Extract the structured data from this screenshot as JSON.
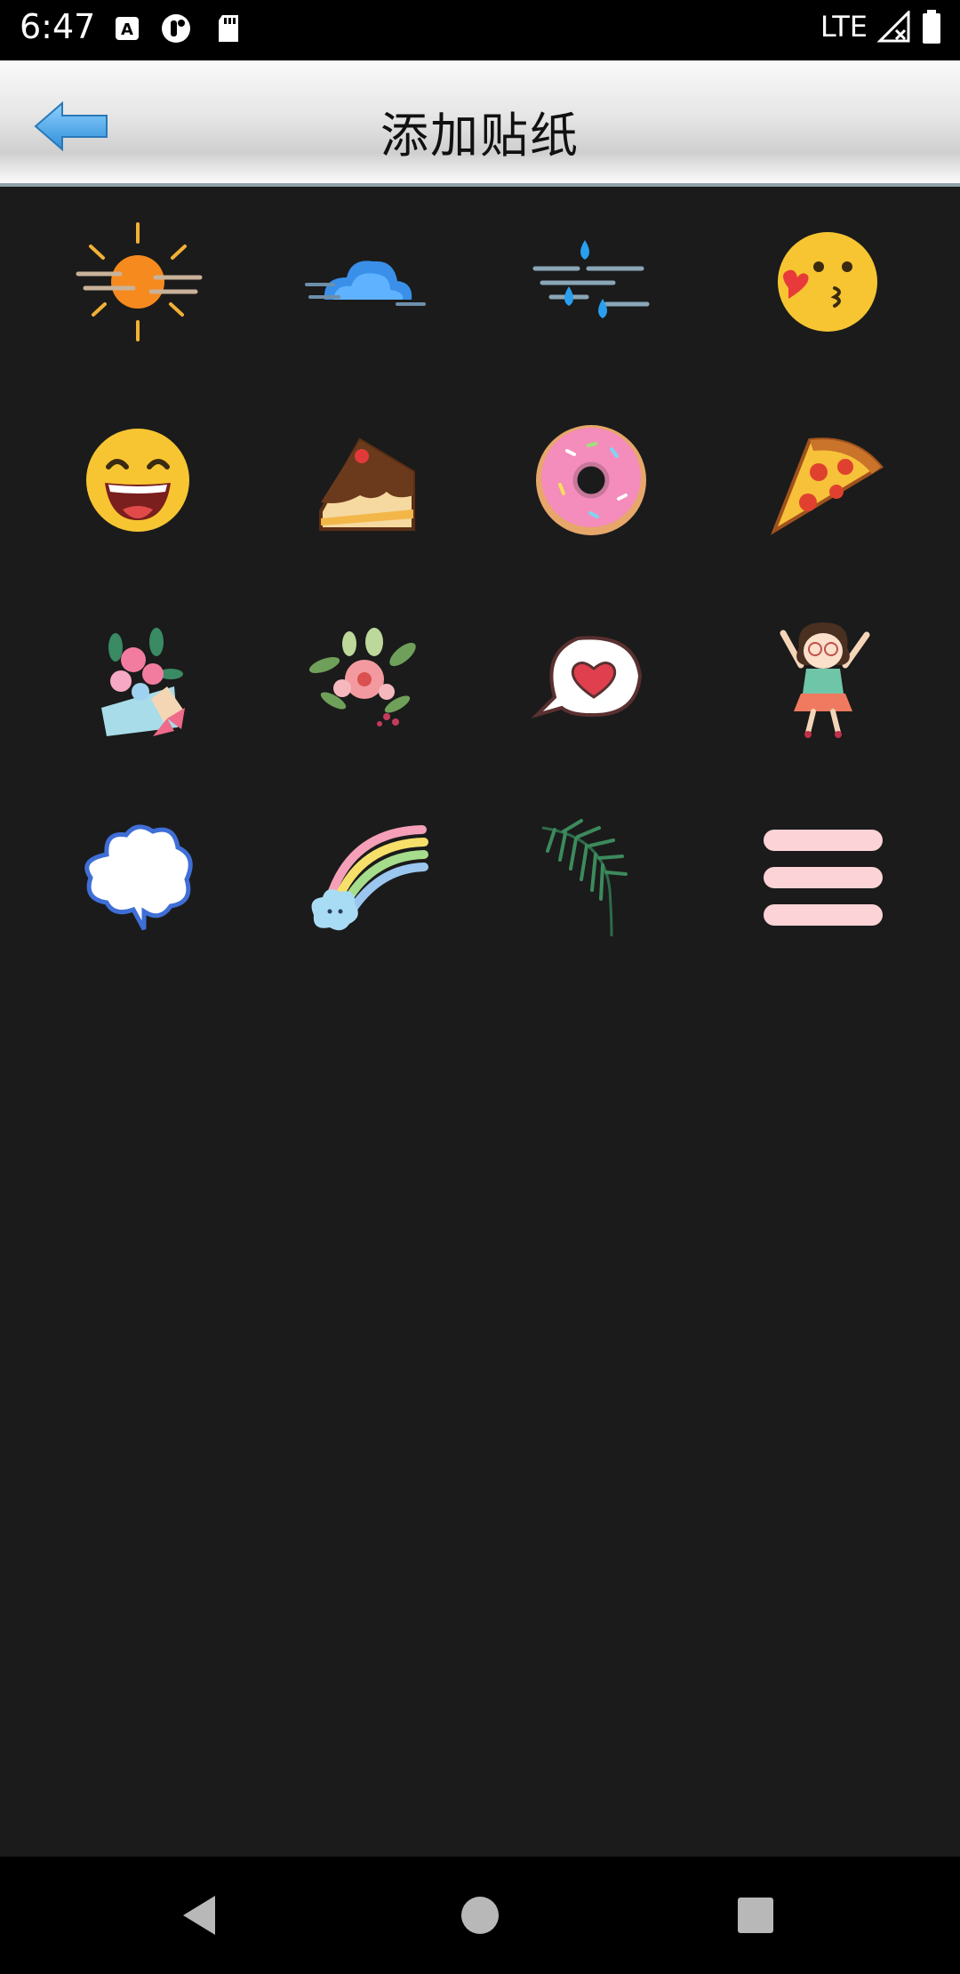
{
  "status_bar": {
    "time": "6:47",
    "network": "LTE",
    "icons": [
      "a-box-icon",
      "vpn-key-icon",
      "sd-card-icon",
      "signal-icon",
      "battery-icon"
    ]
  },
  "header": {
    "title": "添加贴纸",
    "back_icon": "back-arrow-icon",
    "accent": "#4aa6e8"
  },
  "stickers": [
    {
      "name": "sun"
    },
    {
      "name": "cloud"
    },
    {
      "name": "rain"
    },
    {
      "name": "kiss-emoji"
    },
    {
      "name": "grin-emoji"
    },
    {
      "name": "cake-slice"
    },
    {
      "name": "donut"
    },
    {
      "name": "pizza"
    },
    {
      "name": "flower-bouquet"
    },
    {
      "name": "flower-wreath"
    },
    {
      "name": "heart-speech-bubble"
    },
    {
      "name": "jumping-girl"
    },
    {
      "name": "cloud-speech-bubble"
    },
    {
      "name": "rainbow-cloud"
    },
    {
      "name": "palm-leaf"
    },
    {
      "name": "pink-lines"
    }
  ],
  "nav_bar": {
    "icons": [
      "back-triangle-icon",
      "home-circle-icon",
      "recents-square-icon"
    ]
  }
}
